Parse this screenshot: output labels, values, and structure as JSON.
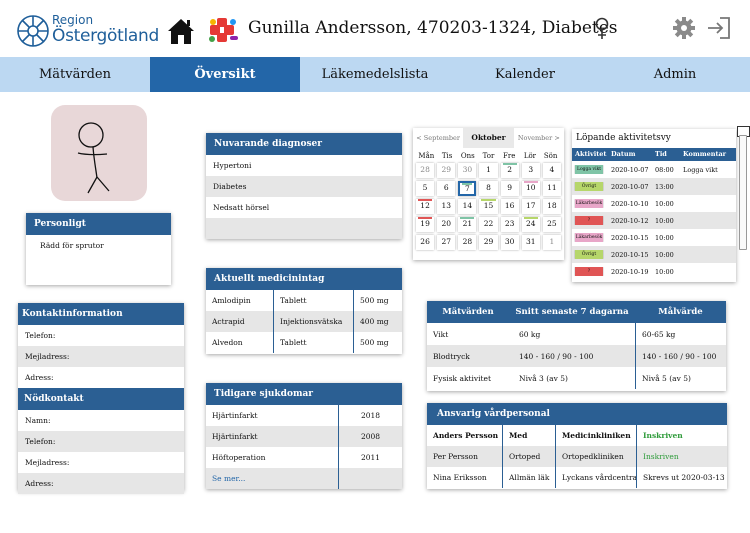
{
  "header": {
    "logo_line1": "Region",
    "logo_line2": "Östergötland",
    "patient_title": "Gunilla Andersson, 470203-1324, Diabetes",
    "icons": [
      "home-icon",
      "medication-icon",
      "female-icon",
      "gear-icon",
      "logout-icon"
    ]
  },
  "nav": {
    "tabs": [
      {
        "label": "Mätvärden"
      },
      {
        "label": "Översikt",
        "active": true
      },
      {
        "label": "Läkemedelslista"
      },
      {
        "label": "Kalender"
      },
      {
        "label": "Admin"
      }
    ]
  },
  "personal": {
    "title": "Personligt",
    "note": "Rädd för sprutor"
  },
  "contact": {
    "title": "Kontaktinformation",
    "phone_label": "Telefon:",
    "email_label": "Mejladress:",
    "address_label": "Adress:"
  },
  "emergency": {
    "title": "Nödkontakt",
    "name_label": "Namn:",
    "phone_label": "Telefon:",
    "email_label": "Mejladress:",
    "address_label": "Adress:"
  },
  "diagnoses": {
    "title": "Nuvarande diagnoser",
    "items": [
      "Hypertoni",
      "Diabetes",
      "Nedsatt hörsel"
    ]
  },
  "medication": {
    "title": "Aktuellt medicinintag",
    "rows": [
      {
        "name": "Amlodipin",
        "form": "Tablett",
        "dose": "500 mg"
      },
      {
        "name": "Actrapid",
        "form": "Injektionsvätska",
        "dose": "400 mg"
      },
      {
        "name": "Alvedon",
        "form": "Tablett",
        "dose": "500 mg"
      }
    ]
  },
  "history": {
    "title": "Tidigare sjukdomar",
    "rows": [
      {
        "name": "Hjärtinfarkt",
        "year": "2018"
      },
      {
        "name": "Hjärtinfarkt",
        "year": "2008"
      },
      {
        "name": "Höftoperation",
        "year": "2011"
      }
    ],
    "more_link": "Se mer..."
  },
  "calendar": {
    "prev": "< September",
    "current": "Oktober",
    "next": "November >",
    "weekdays": [
      "Mån",
      "Tis",
      "Ons",
      "Tor",
      "Fre",
      "Lör",
      "Sön"
    ],
    "days": [
      {
        "d": "28",
        "other": true
      },
      {
        "d": "29",
        "other": true
      },
      {
        "d": "30",
        "other": true
      },
      {
        "d": "1"
      },
      {
        "d": "2",
        "mark": "#7fc4a6"
      },
      {
        "d": "3"
      },
      {
        "d": "4"
      },
      {
        "d": "5"
      },
      {
        "d": "6"
      },
      {
        "d": "7",
        "today": true,
        "mark": "#7fc4a6"
      },
      {
        "d": "8"
      },
      {
        "d": "9"
      },
      {
        "d": "10",
        "mark": "#e8a6c8"
      },
      {
        "d": "11"
      },
      {
        "d": "12",
        "mark": "#e05555"
      },
      {
        "d": "13"
      },
      {
        "d": "14"
      },
      {
        "d": "15",
        "mark": "#b6d66a"
      },
      {
        "d": "16"
      },
      {
        "d": "17"
      },
      {
        "d": "18"
      },
      {
        "d": "19",
        "mark": "#e05555"
      },
      {
        "d": "20"
      },
      {
        "d": "21",
        "mark": "#7fc4a6"
      },
      {
        "d": "22"
      },
      {
        "d": "23"
      },
      {
        "d": "24",
        "mark": "#b6d66a"
      },
      {
        "d": "25"
      },
      {
        "d": "26"
      },
      {
        "d": "27"
      },
      {
        "d": "28"
      },
      {
        "d": "29"
      },
      {
        "d": "30"
      },
      {
        "d": "31"
      },
      {
        "d": "1",
        "other": true
      }
    ]
  },
  "activities": {
    "title": "Löpande aktivitetsvy",
    "columns": [
      "Aktivitet",
      "Datum",
      "Tid",
      "Kommentar"
    ],
    "rows": [
      {
        "tag": "Logga vikt",
        "color": "#7fc4a6",
        "date": "2020-10-07",
        "time": "08:00",
        "comment": "Logga vikt"
      },
      {
        "tag": "Övrigt",
        "color": "#b6d66a",
        "date": "2020-10-07",
        "time": "13:00",
        "comment": ""
      },
      {
        "tag": "Läkarbesök",
        "color": "#e8a6c8",
        "date": "2020-10-10",
        "time": "10:00",
        "comment": ""
      },
      {
        "tag": "?",
        "color": "#e05555",
        "date": "2020-10-12",
        "time": "10:00",
        "comment": ""
      },
      {
        "tag": "Läkarbesök",
        "color": "#e8a6c8",
        "date": "2020-10-15",
        "time": "10:00",
        "comment": ""
      },
      {
        "tag": "Övrigt",
        "color": "#b6d66a",
        "date": "2020-10-15",
        "time": "10:00",
        "comment": ""
      },
      {
        "tag": "?",
        "color": "#e05555",
        "date": "2020-10-19",
        "time": "10:00",
        "comment": ""
      }
    ]
  },
  "measurements": {
    "col1": "Mätvärden",
    "col2": "Snitt senaste 7 dagarna",
    "col3": "Målvärde",
    "rows": [
      {
        "name": "Vikt",
        "avg": "60 kg",
        "target": "60-65 kg"
      },
      {
        "name": "Blodtryck",
        "avg": "140 - 160 / 90 - 100",
        "target": "140 - 160 / 90 - 100"
      },
      {
        "name": "Fysisk aktivitet",
        "avg": "Nivå 3 (av 5)",
        "target": "Nivå 5 (av 5)"
      }
    ]
  },
  "staff": {
    "title": "Ansvarig vårdpersonal",
    "rows": [
      {
        "name": "Anders Persson",
        "role": "Med",
        "clinic": "Medicinkliniken",
        "status": "Inskriven",
        "status_color": "#2e9b3a",
        "bold": true
      },
      {
        "name": "Per Persson",
        "role": "Ortoped",
        "clinic": "Ortopedkliniken",
        "status": "Inskriven",
        "status_color": "#2e9b3a"
      },
      {
        "name": "Nina Eriksson",
        "role": "Allmän läk",
        "clinic": "Lyckans vårdcentral",
        "status": "Skrevs ut 2020-03-13",
        "status_color": "#111111"
      }
    ]
  },
  "colors": {
    "nav_bg": "#bcd8f2",
    "nav_active": "#2366a8",
    "card_header": "#2b5f93",
    "brand": "#1f5f9a"
  }
}
